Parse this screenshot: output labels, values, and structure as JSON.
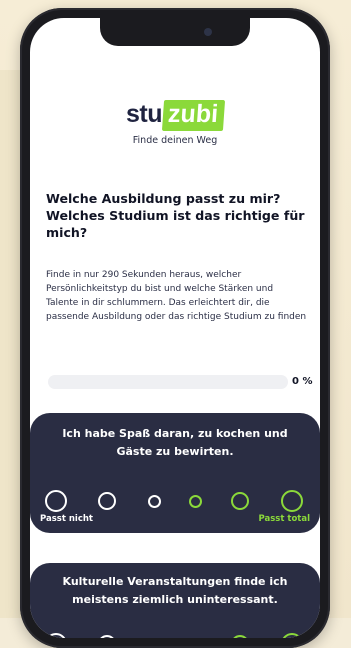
{
  "brand": {
    "name_part1": "stu",
    "name_part2": "zubi",
    "tagline": "Finde deinen Weg",
    "accent_color": "#8bd93a",
    "dark_color": "#2a2d43"
  },
  "intro": {
    "headline": "Welche Ausbildung passt zu mir? Welches Studium ist das richtige für mich?",
    "description": "Finde in nur 290 Sekunden heraus, welcher Persönlichkeitstyp du bist und welche Stärken und Talente in dir schlummern. Das erleichtert dir, die passende Ausbildung oder das richtige Studium zu finden"
  },
  "progress": {
    "value_percent": 0,
    "label": "0 %"
  },
  "questions": [
    {
      "text": "Ich habe Spaß daran, zu kochen und Gäste zu bewirten.",
      "scale_left": "Passt nicht",
      "scale_right": "Passt total",
      "options": [
        {
          "color": "#ffffff"
        },
        {
          "color": "#ffffff"
        },
        {
          "color": "#ffffff"
        },
        {
          "color": "#8bd93a"
        },
        {
          "color": "#8bd93a"
        },
        {
          "color": "#8bd93a"
        }
      ]
    },
    {
      "text": "Kulturelle Veranstaltungen finde ich meistens ziemlich uninteressant.",
      "options": [
        {
          "color": "#ffffff"
        },
        {
          "color": "#ffffff"
        },
        {
          "color": "#ffffff"
        },
        {
          "color": "#8bd93a"
        },
        {
          "color": "#8bd93a"
        },
        {
          "color": "#8bd93a"
        }
      ]
    }
  ]
}
